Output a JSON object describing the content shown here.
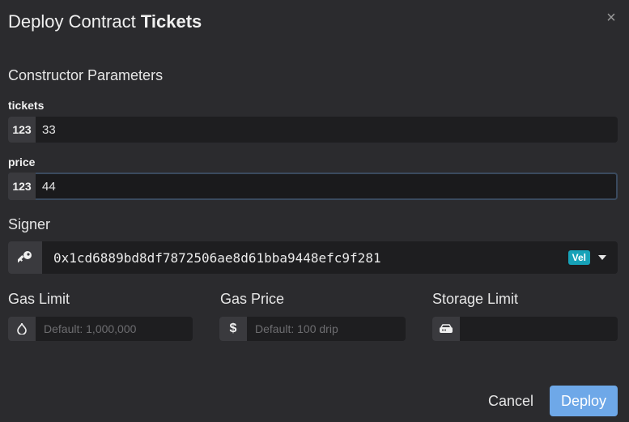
{
  "dialog": {
    "title_prefix": "Deploy Contract",
    "title_contract": "Tickets",
    "close_icon": "close-icon"
  },
  "constructor": {
    "section_title": "Constructor Parameters",
    "params": [
      {
        "name": "tickets",
        "type_badge": "123",
        "value": "33"
      },
      {
        "name": "price",
        "type_badge": "123",
        "value": "44"
      }
    ]
  },
  "signer": {
    "label": "Signer",
    "icon": "key-icon",
    "address": "0x1cd6889bd8df7872506ae8d61bba9448efc9f281",
    "badge": "Vel",
    "badge_color": "#17a2b8"
  },
  "options": {
    "gas_limit": {
      "label": "Gas Limit",
      "icon": "flame-icon",
      "placeholder": "Default: 1,000,000",
      "value": ""
    },
    "gas_price": {
      "label": "Gas Price",
      "icon": "dollar-icon",
      "placeholder": "Default: 100 drip",
      "value": ""
    },
    "storage_limit": {
      "label": "Storage Limit",
      "icon": "storage-icon",
      "placeholder": "",
      "value": ""
    }
  },
  "actions": {
    "cancel_label": "Cancel",
    "deploy_label": "Deploy",
    "deploy_color": "#6ea8e8"
  }
}
